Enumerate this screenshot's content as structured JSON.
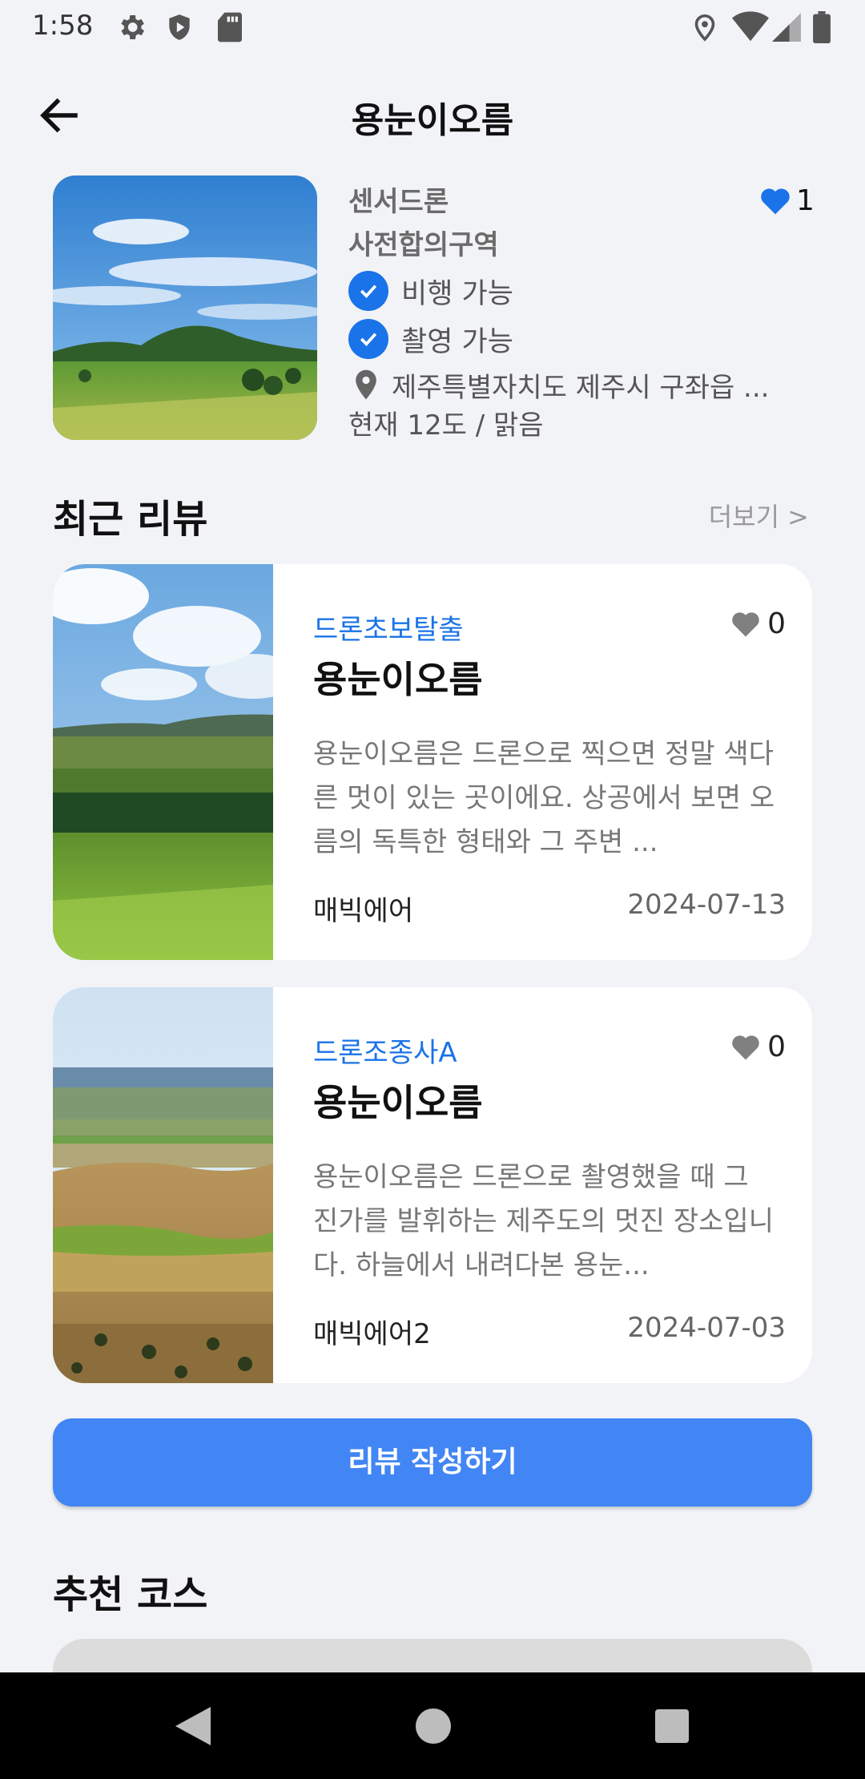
{
  "status_bar": {
    "time": "1:58",
    "icons": [
      "gear-icon",
      "shield-icon",
      "sd-card-icon",
      "location-pin-icon",
      "wifi-icon",
      "cell-signal-icon",
      "battery-icon"
    ]
  },
  "header": {
    "title": "용눈이오름",
    "back_icon": "arrow-left-icon"
  },
  "spot": {
    "zone_line1": "센서드론",
    "zone_line2": "사전합의구역",
    "flight_label": "비행 가능",
    "photo_label": "촬영 가능",
    "address": "제주특별자치도 제주시 구좌읍 ...",
    "weather": "현재 12도 / 맑음",
    "like_count": "1",
    "like_color": "#1a73e8"
  },
  "reviews_section": {
    "title": "최근 리뷰",
    "more": "더보기 >"
  },
  "reviews": [
    {
      "author": "드론초보탈출",
      "likes": "0",
      "title": "용눈이오름",
      "text": "용눈이오름은 드론으로 찍으면 정말 색다른 멋이 있는 곳이에요. 상공에서 보면 오름의 독특한 형태와 그 주변 ...",
      "user": "매빅에어",
      "date": "2024-07-13"
    },
    {
      "author": "드론조종사A",
      "likes": "0",
      "title": "용눈이오름",
      "text": "용눈이오름은 드론으로 촬영했을 때 그 진가를 발휘하는 제주도의 멋진 장소입니다. 하늘에서 내려다본 용눈...",
      "user": "매빅에어2",
      "date": "2024-07-03"
    }
  ],
  "write_review_button": "리뷰 작성하기",
  "courses_section": {
    "title": "추천 코스"
  },
  "colors": {
    "accent": "#1a73e8",
    "button": "#4285f4",
    "background": "#f2f3f6"
  }
}
